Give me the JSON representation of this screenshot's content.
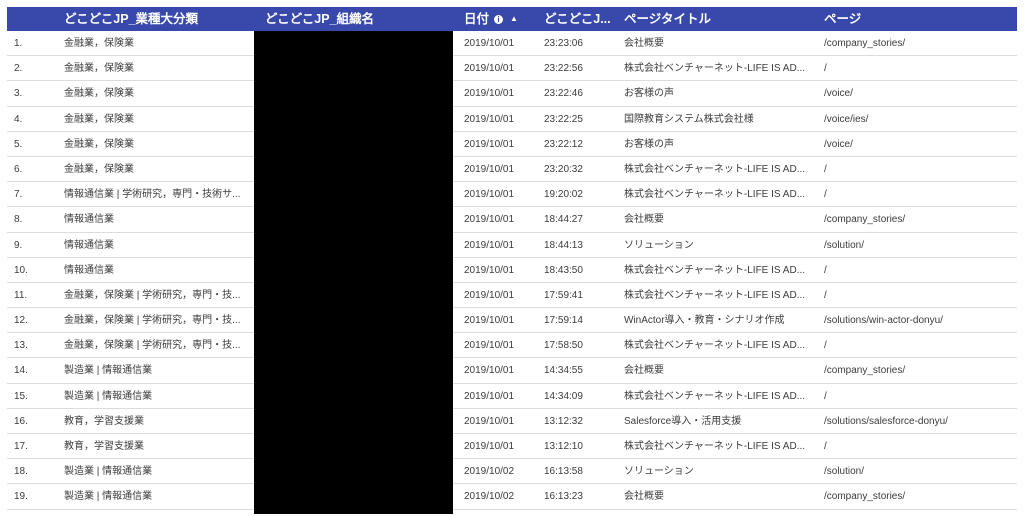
{
  "colors": {
    "header_bg": "#3949ab",
    "header_text": "#ffffff",
    "redaction": "#000000"
  },
  "header": {
    "industry": "どこどこJP_業種大分類",
    "organization": "どこどこJP_組織名",
    "date": "日付",
    "date_info_icon": "info-icon",
    "date_sort_icon": "sort-ascending-icon",
    "time": "どこどこJ...",
    "page_title": "ページタイトル",
    "page": "ページ"
  },
  "rows": [
    {
      "num": "1.",
      "industry": "金融業，保険業",
      "date": "2019/10/01",
      "time": "23:23:06",
      "title": "会社概要",
      "page": "/company_stories/"
    },
    {
      "num": "2.",
      "industry": "金融業，保険業",
      "date": "2019/10/01",
      "time": "23:22:56",
      "title": "株式会社ベンチャーネット-LIFE IS AD...",
      "page": "/"
    },
    {
      "num": "3.",
      "industry": "金融業，保険業",
      "date": "2019/10/01",
      "time": "23:22:46",
      "title": "お客様の声",
      "page": "/voice/"
    },
    {
      "num": "4.",
      "industry": "金融業，保険業",
      "date": "2019/10/01",
      "time": "23:22:25",
      "title": "国際教育システム株式会社様",
      "page": "/voice/ies/"
    },
    {
      "num": "5.",
      "industry": "金融業，保険業",
      "date": "2019/10/01",
      "time": "23:22:12",
      "title": "お客様の声",
      "page": "/voice/"
    },
    {
      "num": "6.",
      "industry": "金融業，保険業",
      "date": "2019/10/01",
      "time": "23:20:32",
      "title": "株式会社ベンチャーネット-LIFE IS AD...",
      "page": "/"
    },
    {
      "num": "7.",
      "industry": "情報通信業 | 学術研究，専門・技術サ...",
      "date": "2019/10/01",
      "time": "19:20:02",
      "title": "株式会社ベンチャーネット-LIFE IS AD...",
      "page": "/"
    },
    {
      "num": "8.",
      "industry": "情報通信業",
      "date": "2019/10/01",
      "time": "18:44:27",
      "title": "会社概要",
      "page": "/company_stories/"
    },
    {
      "num": "9.",
      "industry": "情報通信業",
      "date": "2019/10/01",
      "time": "18:44:13",
      "title": "ソリューション",
      "page": "/solution/"
    },
    {
      "num": "10.",
      "industry": "情報通信業",
      "date": "2019/10/01",
      "time": "18:43:50",
      "title": "株式会社ベンチャーネット-LIFE IS AD...",
      "page": "/"
    },
    {
      "num": "11.",
      "industry": "金融業，保険業 | 学術研究，専門・技...",
      "date": "2019/10/01",
      "time": "17:59:41",
      "title": "株式会社ベンチャーネット-LIFE IS AD...",
      "page": "/"
    },
    {
      "num": "12.",
      "industry": "金融業，保険業 | 学術研究，専門・技...",
      "date": "2019/10/01",
      "time": "17:59:14",
      "title": "WinActor導入・教育・シナリオ作成",
      "page": "/solutions/win-actor-donyu/"
    },
    {
      "num": "13.",
      "industry": "金融業，保険業 | 学術研究，専門・技...",
      "date": "2019/10/01",
      "time": "17:58:50",
      "title": "株式会社ベンチャーネット-LIFE IS AD...",
      "page": "/"
    },
    {
      "num": "14.",
      "industry": "製造業 | 情報通信業",
      "date": "2019/10/01",
      "time": "14:34:55",
      "title": "会社概要",
      "page": "/company_stories/"
    },
    {
      "num": "15.",
      "industry": "製造業 | 情報通信業",
      "date": "2019/10/01",
      "time": "14:34:09",
      "title": "株式会社ベンチャーネット-LIFE IS AD...",
      "page": "/"
    },
    {
      "num": "16.",
      "industry": "教育，学習支援業",
      "date": "2019/10/01",
      "time": "13:12:32",
      "title": "Salesforce導入・活用支援",
      "page": "/solutions/salesforce-donyu/"
    },
    {
      "num": "17.",
      "industry": "教育，学習支援業",
      "date": "2019/10/01",
      "time": "13:12:10",
      "title": "株式会社ベンチャーネット-LIFE IS AD...",
      "page": "/"
    },
    {
      "num": "18.",
      "industry": "製造業 | 情報通信業",
      "date": "2019/10/02",
      "time": "16:13:58",
      "title": "ソリューション",
      "page": "/solution/"
    },
    {
      "num": "19.",
      "industry": "製造業 | 情報通信業",
      "date": "2019/10/02",
      "time": "16:13:23",
      "title": "会社概要",
      "page": "/company_stories/"
    }
  ]
}
